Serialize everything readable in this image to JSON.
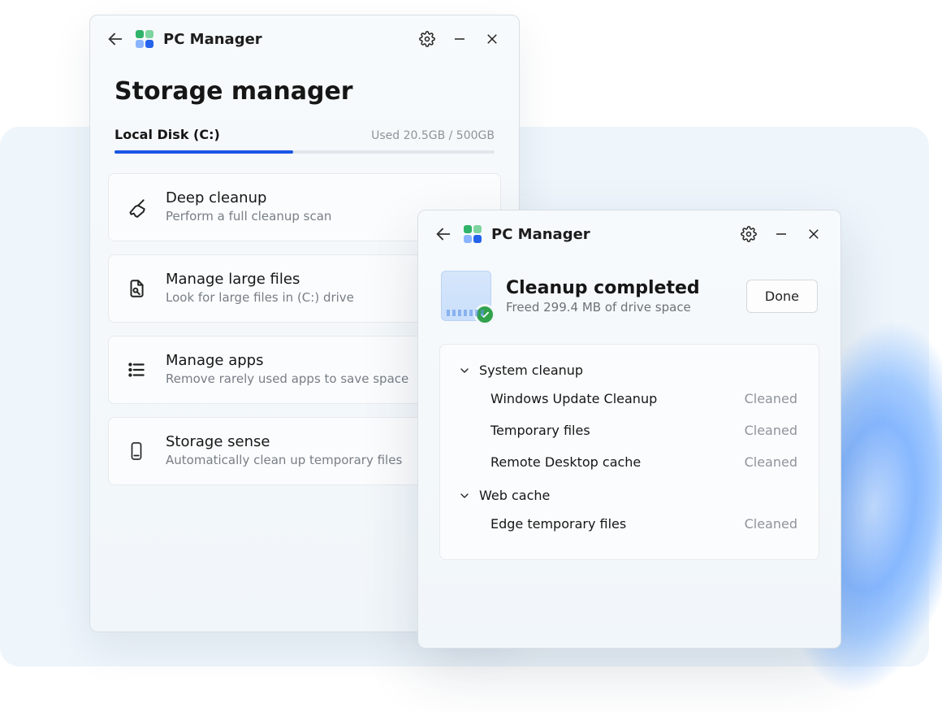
{
  "app": {
    "title": "PC Manager"
  },
  "storage": {
    "page_title": "Storage manager",
    "disk": {
      "name": "Local Disk (C:)",
      "used_label": "Used 20.5GB / 500GB",
      "used_gb": 20.5,
      "total_gb": 500,
      "fill_ratio": 0.47
    },
    "cards": [
      {
        "id": "deep-cleanup",
        "title": "Deep cleanup",
        "subtitle": "Perform a full cleanup scan"
      },
      {
        "id": "large-files",
        "title": "Manage large files",
        "subtitle": "Look for large files in (C:) drive"
      },
      {
        "id": "manage-apps",
        "title": "Manage apps",
        "subtitle": "Remove rarely used apps to save space"
      },
      {
        "id": "storage-sense",
        "title": "Storage sense",
        "subtitle": "Automatically clean up temporary files"
      }
    ]
  },
  "cleanup": {
    "title": "Cleanup completed",
    "subtitle": "Freed 299.4 MB of drive space",
    "freed_mb": 299.4,
    "done_label": "Done",
    "groups": [
      {
        "id": "system-cleanup",
        "label": "System cleanup",
        "items": [
          {
            "name": "Windows Update Cleanup",
            "status": "Cleaned"
          },
          {
            "name": "Temporary files",
            "status": "Cleaned"
          },
          {
            "name": "Remote Desktop cache",
            "status": "Cleaned"
          }
        ]
      },
      {
        "id": "web-cache",
        "label": "Web cache",
        "items": [
          {
            "name": "Edge temporary files",
            "status": "Cleaned"
          }
        ]
      }
    ]
  }
}
